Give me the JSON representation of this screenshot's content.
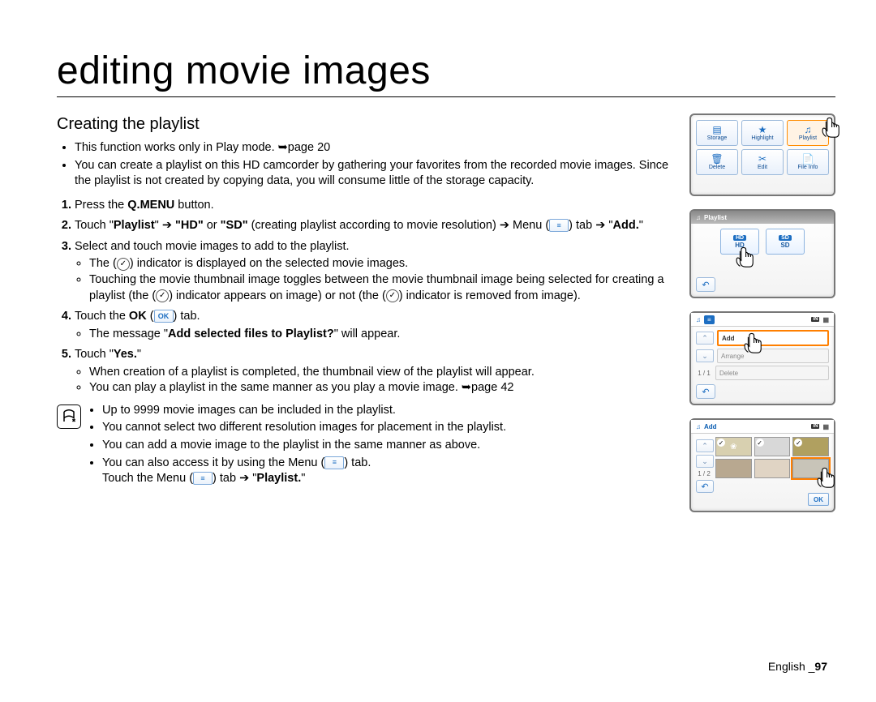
{
  "title": "editing movie images",
  "section_heading": "Creating the playlist",
  "intro": [
    "This function works only in Play mode. ➥page 20",
    "You can create a playlist on this HD camcorder by gathering your favorites from the recorded movie images. Since the playlist is not created by copying data, you will consume little of the storage capacity."
  ],
  "steps": {
    "s1_a": "Press the ",
    "s1_b": "Q.MENU",
    "s1_c": " button.",
    "s2_a": "Touch \"",
    "s2_playlist": "Playlist",
    "s2_b": "\" ➔ ",
    "s2_hd": "\"HD\"",
    "s2_c": " or ",
    "s2_sd": "\"SD\"",
    "s2_d": " (creating playlist according to movie resolution) ➔ Menu (",
    "s2_e": ") tab ➔ \"",
    "s2_add": "Add.",
    "s2_f": "\"",
    "s3": "Select and touch movie images to add to the playlist.",
    "s3_sub": [
      "The ( ✓ ) indicator is displayed on the selected movie images.",
      "Touching the movie thumbnail image toggles between the movie thumbnail image being selected for creating a playlist (the ( ✓ ) indicator appears on image) or not (the ( ✓ ) indicator is removed from image)."
    ],
    "s4_a": "Touch the ",
    "s4_ok": "OK",
    "s4_b": " (",
    "s4_c": ") tab.",
    "s4_sub_a": "The message \"",
    "s4_sub_b": "Add selected files to Playlist?",
    "s4_sub_c": "\" will appear.",
    "s5_a": "Touch \"",
    "s5_yes": "Yes.",
    "s5_b": "\"",
    "s5_sub": [
      "When creation of a playlist is completed, the thumbnail view of the playlist will appear.",
      "You can play a playlist in the same manner as you play a movie image. ➥page 42"
    ]
  },
  "notes": [
    "Up to 9999 movie images can be included in the playlist.",
    "You cannot select two different resolution images for placement in the playlist.",
    "You can add a movie image to the playlist in the same manner as above.",
    "You can also access it by using the Menu (   ) tab."
  ],
  "note_tail_a": "Touch the Menu (",
  "note_tail_b": ") tab ➔ \"",
  "note_tail_c": "Playlist.",
  "note_tail_d": "\"",
  "footer_lang": "English _",
  "footer_page": "97",
  "fig1": {
    "items": [
      "Storage",
      "Highlight",
      "Playlist",
      "Delete",
      "Edit",
      "File Info"
    ]
  },
  "fig2": {
    "title": "Playlist",
    "hd": "HD",
    "sd": "SD"
  },
  "fig3": {
    "items": [
      "Add",
      "Arrange",
      "Delete"
    ],
    "page": "1 / 1"
  },
  "fig4": {
    "title": "Add",
    "page": "1 / 2",
    "ok": "OK"
  },
  "icons": {
    "menu": "≡",
    "ok": "OK",
    "check": "✓",
    "return": "↶"
  }
}
